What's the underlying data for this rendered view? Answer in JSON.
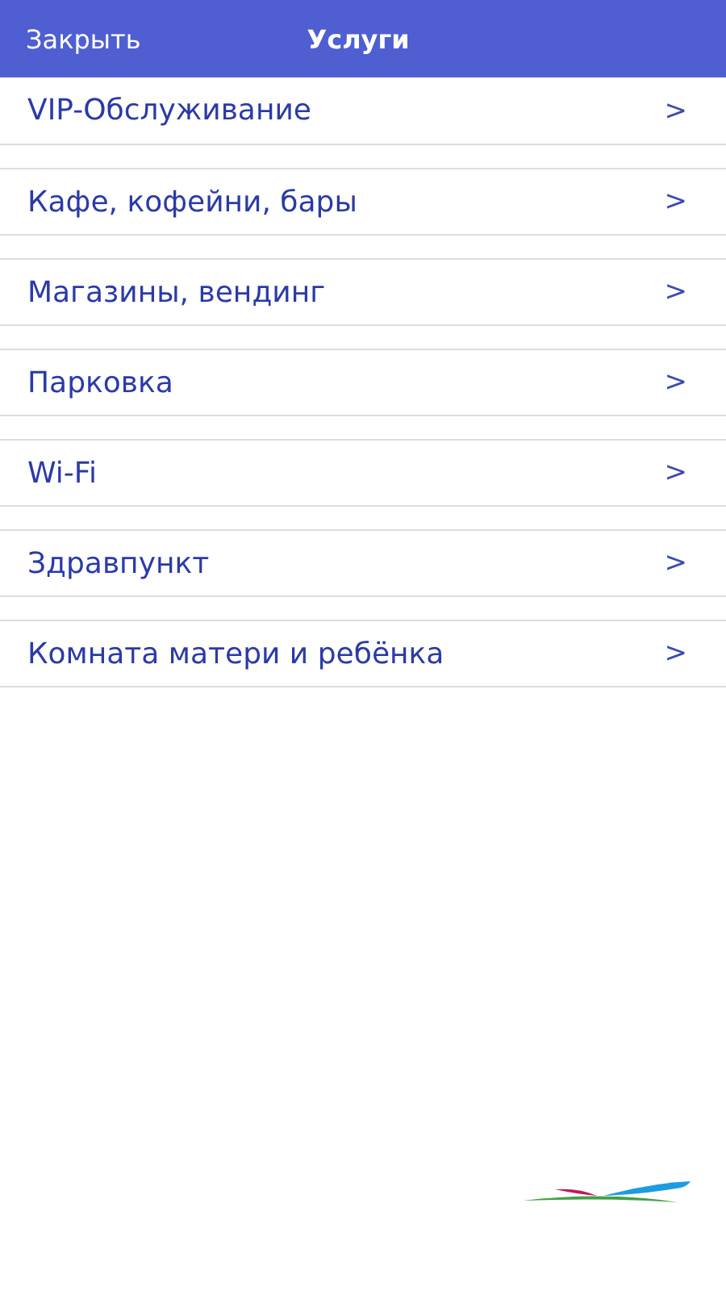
{
  "header": {
    "close": "Закрыть",
    "title": "Услуги"
  },
  "items": [
    {
      "label": "VIP-Обслуживание",
      "chevron": ">"
    },
    {
      "label": "Кафе, кофейни, бары",
      "chevron": ">"
    },
    {
      "label": "Магазины, вендинг",
      "chevron": ">"
    },
    {
      "label": "Парковка",
      "chevron": ">"
    },
    {
      "label": "Wi-Fi",
      "chevron": ">"
    },
    {
      "label": "Здравпункт",
      "chevron": ">"
    },
    {
      "label": "Комната матери и ребёнка",
      "chevron": ">"
    }
  ]
}
